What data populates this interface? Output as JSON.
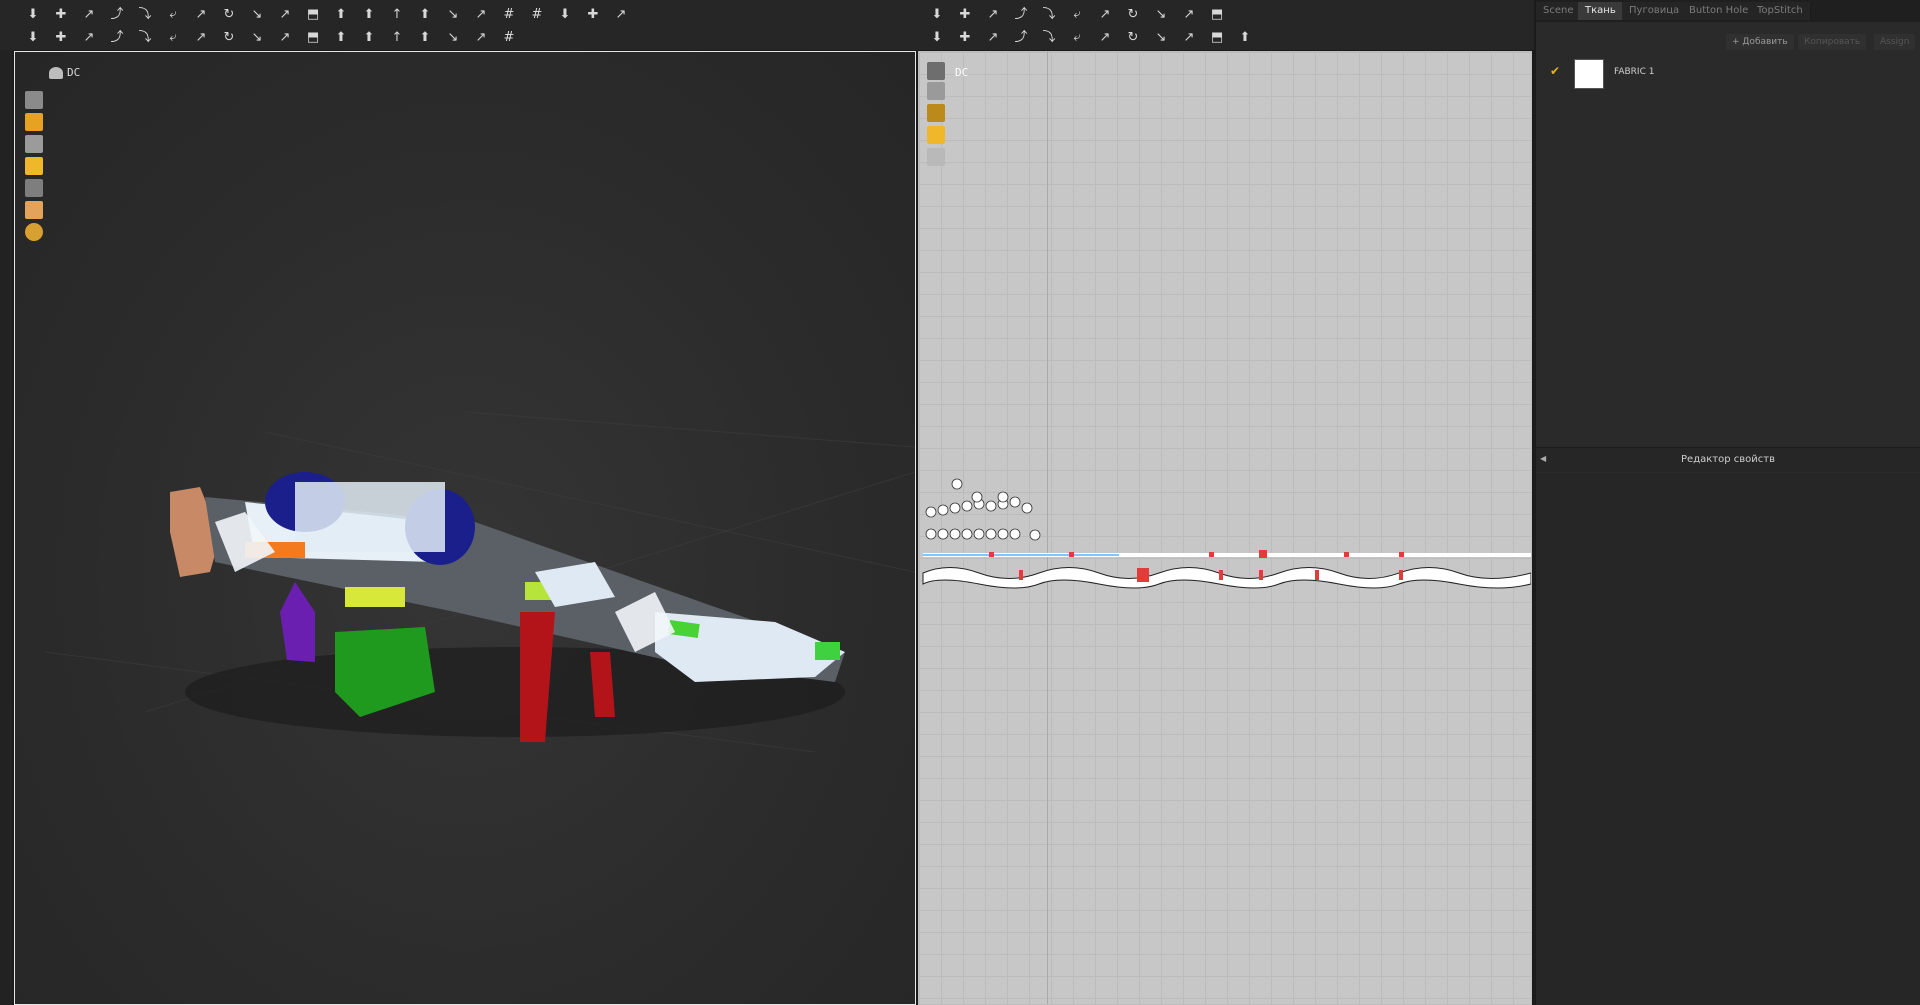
{
  "viewport3d": {
    "label": "DC"
  },
  "viewport2d": {
    "label": "DC"
  },
  "right_panel": {
    "tabs": [
      {
        "label": "Scene",
        "active": false
      },
      {
        "label": "Ткань",
        "active": true
      },
      {
        "label": "Пуговица",
        "active": false
      },
      {
        "label": "Button Hole",
        "active": false
      },
      {
        "label": "TopStitch",
        "active": false
      }
    ],
    "buttons": {
      "add": "+ Добавить",
      "copy": "Копировать",
      "assign": "Assign"
    },
    "fabric": {
      "name": "FABRIC 1",
      "checked": true,
      "swatch_color": "#ffffff",
      "check_color": "#e8b21a"
    },
    "property_editor_title": "Редактор свойств"
  },
  "colors": {
    "panel_bg": "#2a2a2a",
    "viewport3d_border": "#e6e6e6",
    "viewport2d_bg": "#c7c7c7",
    "accent": "#e8b21a"
  }
}
